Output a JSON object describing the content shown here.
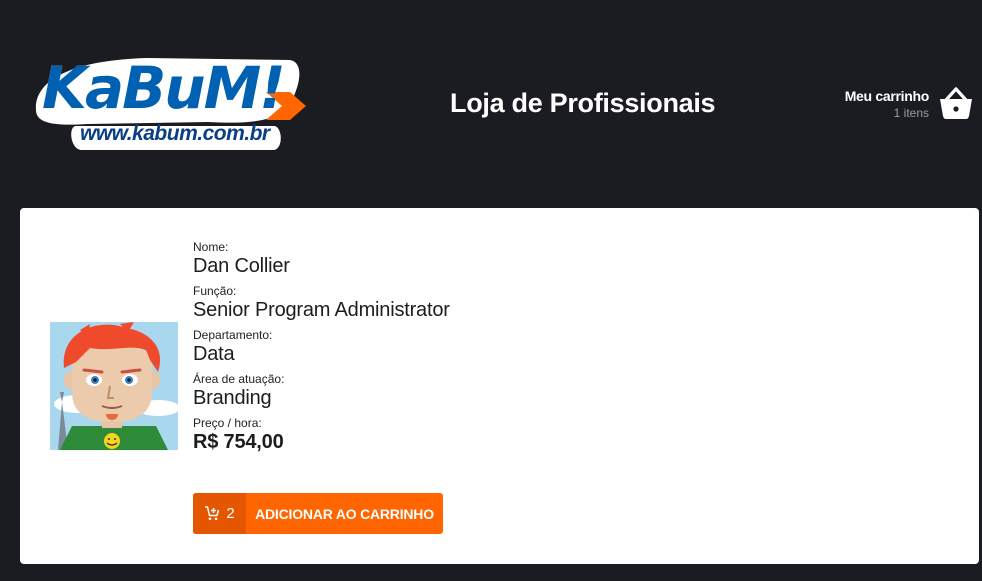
{
  "brand": {
    "logo_text": "KaBuM!",
    "logo_url": "www.kabum.com.br",
    "colors": {
      "primary_blue": "#0060b1",
      "orange": "#ff6500",
      "header_bg": "#1b1c22"
    }
  },
  "header": {
    "title": "Loja de Profissionais"
  },
  "cart": {
    "title": "Meu carrinho",
    "count_text": "1 itens",
    "icon": "basket-icon"
  },
  "professional": {
    "name_label": "Nome:",
    "name": "Dan Collier",
    "role_label": "Função:",
    "role": "Senior Program Administrator",
    "department_label": "Departamento:",
    "department": "Data",
    "area_label": "Área de atuação:",
    "area": "Branding",
    "price_label": "Preço / hora:",
    "price": "R$ 754,00"
  },
  "add_button": {
    "quantity": "2",
    "label": "ADICIONAR AO CARRINHO",
    "icon": "cart-add-icon"
  }
}
